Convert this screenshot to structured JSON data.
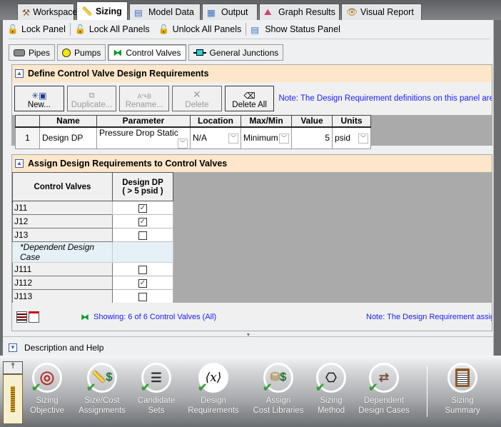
{
  "tabs": [
    {
      "label": "Workspace",
      "icon": "hammer-icon"
    },
    {
      "label": "Sizing",
      "icon": "ruler-icon",
      "active": true
    },
    {
      "label": "Model Data",
      "icon": "notebook-icon"
    },
    {
      "label": "Output",
      "icon": "table-icon"
    },
    {
      "label": "Graph Results",
      "icon": "graph-icon"
    },
    {
      "label": "Visual Report",
      "icon": "eye-icon"
    }
  ],
  "toolbar": {
    "lock_panel": "Lock Panel",
    "lock_all": "Lock All Panels",
    "unlock_all": "Unlock All Panels",
    "show_status": "Show Status Panel"
  },
  "subtabs": [
    {
      "label": "Pipes"
    },
    {
      "label": "Pumps"
    },
    {
      "label": "Control Valves",
      "selected": true
    },
    {
      "label": "General Junctions"
    }
  ],
  "define": {
    "title": "Define Control Valve Design Requirements",
    "buttons": [
      {
        "label": "New...",
        "enabled": true
      },
      {
        "label": "Duplicate...",
        "enabled": false
      },
      {
        "label": "Rename...",
        "enabled": false
      },
      {
        "label": "Delete",
        "enabled": false
      },
      {
        "label": "Delete All",
        "enabled": true
      }
    ],
    "note": "Note: The Design Requirement definitions on this panel are co",
    "columns": [
      "",
      "Name",
      "Parameter",
      "Location",
      "Max/Min",
      "Value",
      "Units"
    ],
    "rows": [
      {
        "num": "1",
        "name": "Design DP",
        "parameter": "Pressure Drop Static",
        "location": "N/A",
        "maxmin": "Minimum",
        "value": "5",
        "units": "psid"
      }
    ]
  },
  "assign": {
    "title": "Assign Design Requirements to Control Valves",
    "col1": "Control Valves",
    "col2_line1": "Design DP",
    "col2_line2": "( > 5 psid )",
    "rows": [
      {
        "name": "J11",
        "checked": true
      },
      {
        "name": "J12",
        "checked": true
      },
      {
        "name": "J13",
        "checked": false
      },
      {
        "name": "*Dependent Design Case",
        "group": true
      },
      {
        "name": "J111",
        "checked": false
      },
      {
        "name": "J112",
        "checked": true
      },
      {
        "name": "J113",
        "checked": false
      }
    ],
    "showing": "Showing: 6 of 6 Control Valves (All)",
    "note": "Note: The Design Requirement assig"
  },
  "description": "Description and Help",
  "bottom_tools": [
    {
      "l1": "Sizing",
      "l2": "Objective",
      "done": true
    },
    {
      "l1": "Size/Cost",
      "l2": "Assignments",
      "done": true
    },
    {
      "l1": "Candidate",
      "l2": "Sets",
      "done": true
    },
    {
      "l1": "Design",
      "l2": "Requirements",
      "done": true
    },
    {
      "l1": "Assign",
      "l2": "Cost Libraries",
      "done": true
    },
    {
      "l1": "Sizing",
      "l2": "Method",
      "done": true
    },
    {
      "l1": "Dependent",
      "l2": "Design Cases",
      "done": true
    },
    {
      "l1": "Sizing",
      "l2": "Summary",
      "done": false
    }
  ]
}
